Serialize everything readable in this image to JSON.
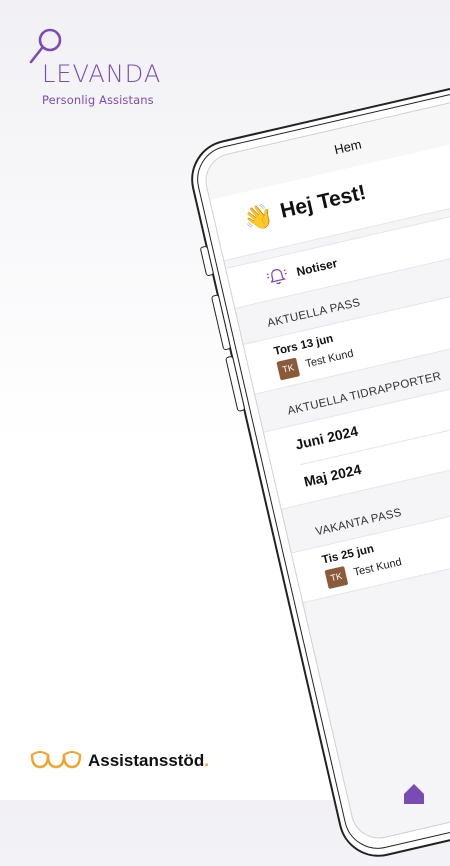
{
  "logo": {
    "word": "LEVANDA",
    "tagline": "Personlig Assistans",
    "color": "#7a4cb3"
  },
  "nav": {
    "title": "Hem"
  },
  "greeting": {
    "emoji": "👋",
    "text": "Hej Test!"
  },
  "notices": {
    "label": "Notiser",
    "icon": "bell-icon"
  },
  "current_shifts": {
    "header": "AKTUELLA PASS",
    "items": [
      {
        "date": "Tors 13 jun",
        "initials": "TK",
        "customer": "Test Kund"
      }
    ]
  },
  "time_reports": {
    "header": "AKTUELLA TIDRAPPORTER",
    "items": [
      {
        "label": "Juni 2024"
      },
      {
        "label": "Maj 2024"
      }
    ]
  },
  "vacant_shifts": {
    "header": "VAKANTA PASS",
    "items": [
      {
        "date": "Tis 25 jun",
        "initials": "TK",
        "customer": "Test Kund"
      }
    ]
  },
  "footer_brand": {
    "name": "Assistansstöd",
    "dot": ".",
    "accent": "#f0a531"
  }
}
